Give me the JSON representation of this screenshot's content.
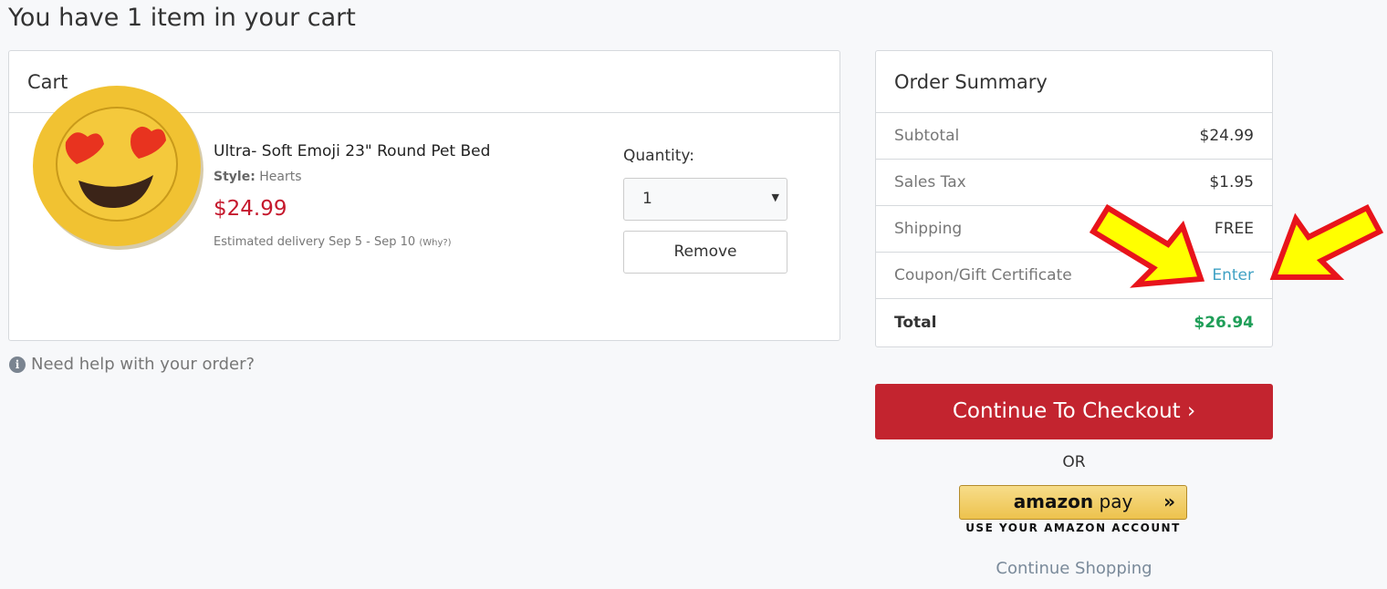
{
  "page_title": "You have 1 item in your cart",
  "cart": {
    "header": "Cart",
    "item": {
      "name": "Ultra- Soft Emoji 23\" Round Pet Bed",
      "style_label": "Style:",
      "style_value": "Hearts",
      "price": "$24.99",
      "delivery": "Estimated delivery Sep 5 - Sep 10",
      "why": "(Why?)"
    },
    "quantity_label": "Quantity:",
    "quantity_value": "1",
    "remove_label": "Remove"
  },
  "help": {
    "icon": "info-icon",
    "text": "Need help with your order?"
  },
  "summary": {
    "header": "Order Summary",
    "rows": [
      {
        "label": "Subtotal",
        "value": "$24.99"
      },
      {
        "label": "Sales Tax",
        "value": "$1.95"
      },
      {
        "label": "Shipping",
        "value": "FREE"
      },
      {
        "label": "Coupon/Gift Certificate",
        "value": "Enter"
      },
      {
        "label": "Total",
        "value": "$26.94"
      }
    ]
  },
  "checkout_label": "Continue To Checkout",
  "or_label": "OR",
  "amazon": {
    "brand": "amazon",
    "pay": "pay",
    "sub": "USE YOUR AMAZON ACCOUNT"
  },
  "continue_shopping": "Continue Shopping",
  "colors": {
    "accent": "#c3242f",
    "total": "#1f9e58",
    "link": "#3fa1c4",
    "price": "#c5192d",
    "arrow_fill": "#ffff00",
    "arrow_stroke": "#e8141b"
  }
}
